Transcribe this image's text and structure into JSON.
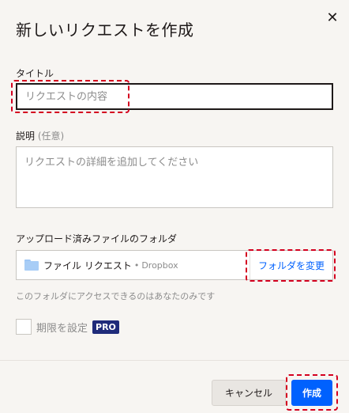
{
  "dialog": {
    "title": "新しいリクエストを作成",
    "close_glyph": "✕"
  },
  "fields": {
    "title_label": "タイトル",
    "title_placeholder": "リクエストの内容",
    "description_label": "説明",
    "description_optional": "(任意)",
    "description_placeholder": "リクエストの詳細を追加してください"
  },
  "folder": {
    "label": "アップロード済みファイルのフォルダ",
    "name": "ファイル リクエスト",
    "separator": "•",
    "source": "Dropbox",
    "change_link": "フォルダを変更",
    "hint": "このフォルダにアクセスできるのはあなたのみです"
  },
  "deadline": {
    "label": "期限を設定",
    "badge": "PRO",
    "checked": false
  },
  "footer": {
    "cancel_label": "キャンセル",
    "create_label": "作成"
  },
  "colors": {
    "accent": "#0061fe",
    "pro_badge": "#1f2b7a",
    "highlight": "#d4001f",
    "background": "#f7f5f2"
  }
}
